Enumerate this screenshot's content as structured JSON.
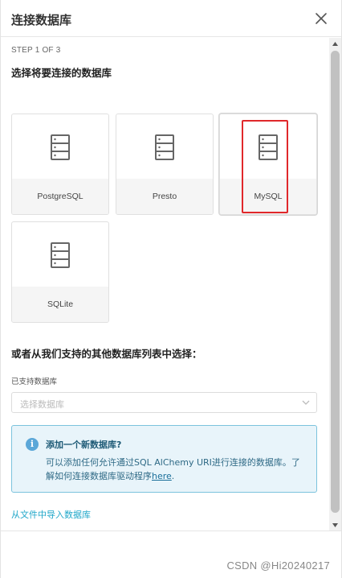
{
  "modal": {
    "title": "连接数据库"
  },
  "step": "STEP 1 OF 3",
  "heading": "选择将要连接的数据库",
  "databases": [
    {
      "label": "PostgreSQL",
      "icon": "database-icon"
    },
    {
      "label": "Presto",
      "icon": "database-icon"
    },
    {
      "label": "MySQL",
      "icon": "database-icon"
    },
    {
      "label": "SQLite",
      "icon": "database-icon"
    }
  ],
  "other": {
    "heading": "或者从我们支持的其他数据库列表中选择：",
    "field_label": "已支持数据库",
    "placeholder": "选择数据库"
  },
  "alert": {
    "title": "添加一个新数据库?",
    "body": "可以添加任何允许通过SQL AlChemy URI进行连接的数据库。了解如何连接数据库驱动程序",
    "link": "here",
    "end": "."
  },
  "import_link": "从文件中导入数据库",
  "watermark": "CSDN @Hi20240217",
  "colors": {
    "highlight": "#e0282b",
    "info_bg": "#e8f4fa",
    "info_border": "#7cc3dd",
    "link": "#20a7c9"
  }
}
